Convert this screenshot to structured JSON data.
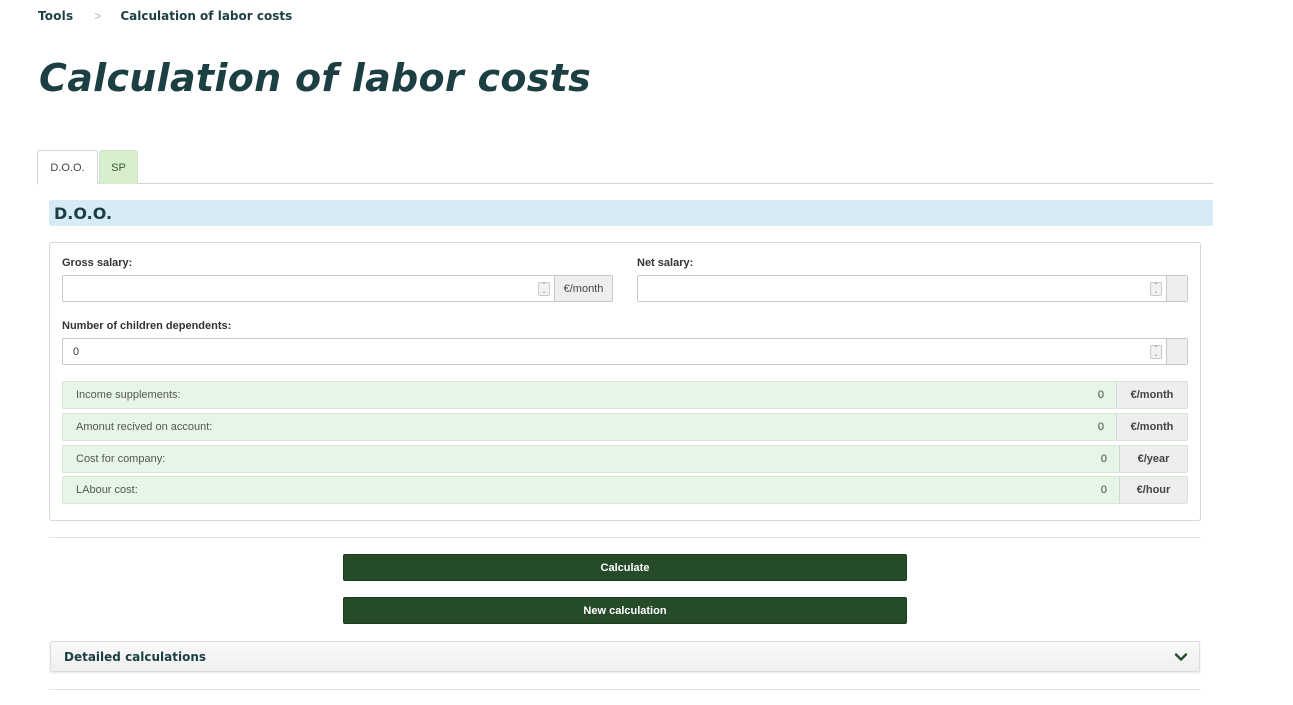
{
  "breadcrumb": {
    "parent": "Tools",
    "separator": ">",
    "current": "Calculation of labor costs"
  },
  "page_title": "Calculation of labor costs",
  "tabs": [
    {
      "label": "D.O.O.",
      "active": true
    },
    {
      "label": "SP",
      "active": false
    }
  ],
  "section_title": "D.O.O.",
  "form": {
    "gross_salary": {
      "label": "Gross salary:",
      "value": "",
      "unit": "€/month"
    },
    "net_salary": {
      "label": "Net salary:",
      "value": "",
      "unit": ""
    },
    "children": {
      "label": "Number of children dependents:",
      "value": "0",
      "unit": ""
    }
  },
  "results": [
    {
      "label": "Income supplements:",
      "value": "0",
      "unit": "€/month"
    },
    {
      "label": "Amonut recived on account:",
      "value": "0",
      "unit": "€/month"
    },
    {
      "label": "Cost for company:",
      "value": "0",
      "unit": "€/year"
    },
    {
      "label": "LAbour cost:",
      "value": "0",
      "unit": "€/hour"
    }
  ],
  "buttons": {
    "calculate": "Calculate",
    "new_calculation": "New calculation"
  },
  "accordion": {
    "title": "Detailed calculations",
    "icon": "chevron-down-icon"
  },
  "colors": {
    "brand_dark": "#1c3f43",
    "button": "#264b29",
    "result_bg": "#e6f6e6",
    "section_bg": "#d6ebf5",
    "tab_inactive": "#d8efcf"
  }
}
